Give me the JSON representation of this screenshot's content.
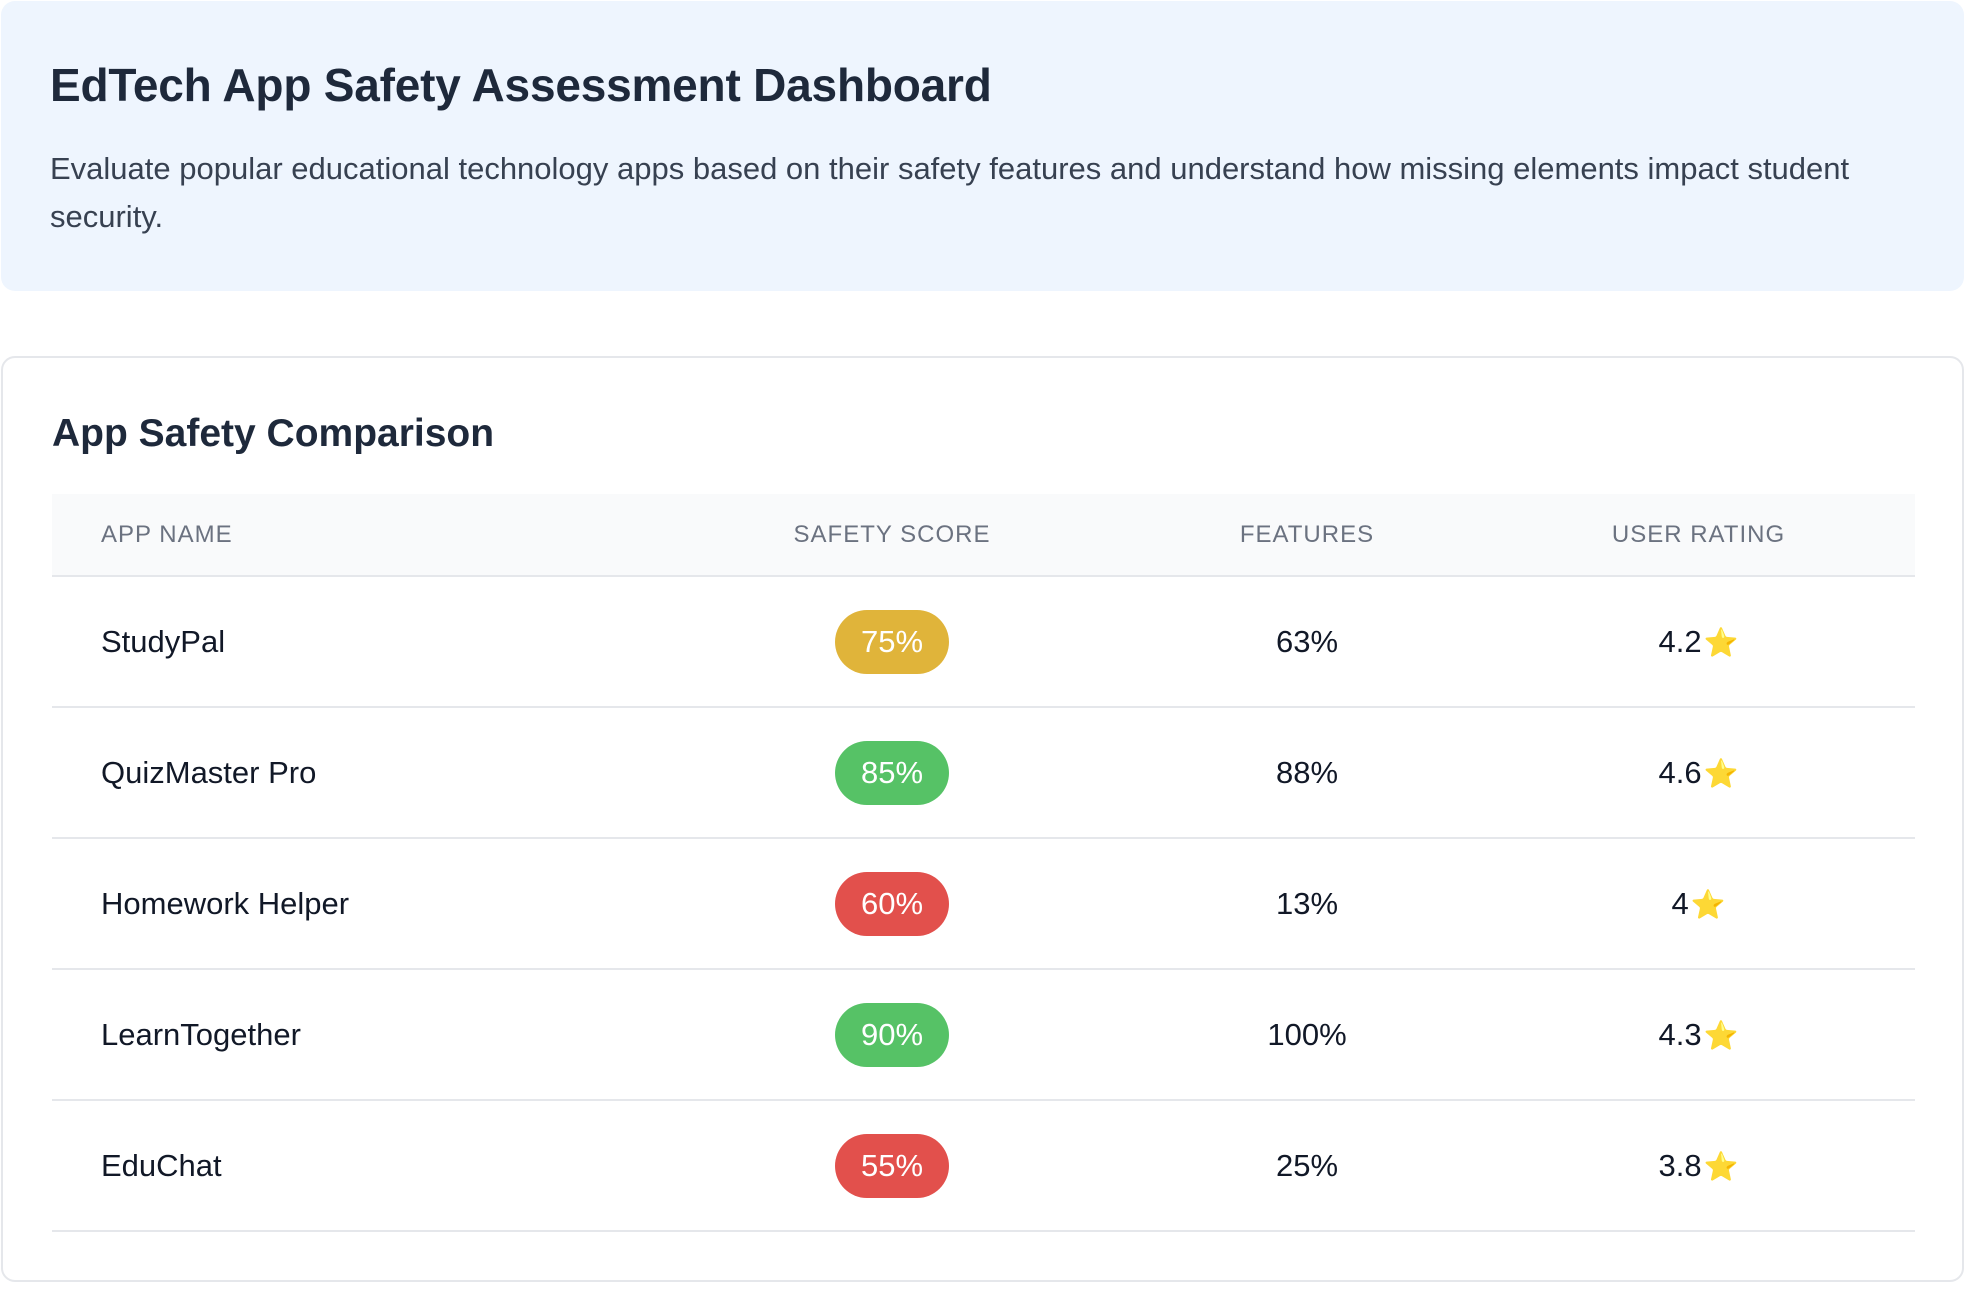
{
  "header": {
    "title": "EdTech App Safety Assessment Dashboard",
    "description": "Evaluate popular educational technology apps based on their safety features and understand how missing elements impact student security."
  },
  "comparison": {
    "title": "App Safety Comparison",
    "columns": [
      "APP NAME",
      "SAFETY SCORE",
      "FEATURES",
      "USER RATING"
    ],
    "rows": [
      {
        "name": "StudyPal",
        "safety_score": "75%",
        "score_color": "#e0b43a",
        "features": "63%",
        "rating": "4.2"
      },
      {
        "name": "QuizMaster Pro",
        "safety_score": "85%",
        "score_color": "#56c266",
        "features": "88%",
        "rating": "4.6"
      },
      {
        "name": "Homework Helper",
        "safety_score": "60%",
        "score_color": "#e2504c",
        "features": "13%",
        "rating": "4"
      },
      {
        "name": "LearnTogether",
        "safety_score": "90%",
        "score_color": "#56c266",
        "features": "100%",
        "rating": "4.3"
      },
      {
        "name": "EduChat",
        "safety_score": "55%",
        "score_color": "#e2504c",
        "features": "25%",
        "rating": "3.8"
      }
    ],
    "rating_icon": "star-icon",
    "rating_glyph": "⭐"
  }
}
